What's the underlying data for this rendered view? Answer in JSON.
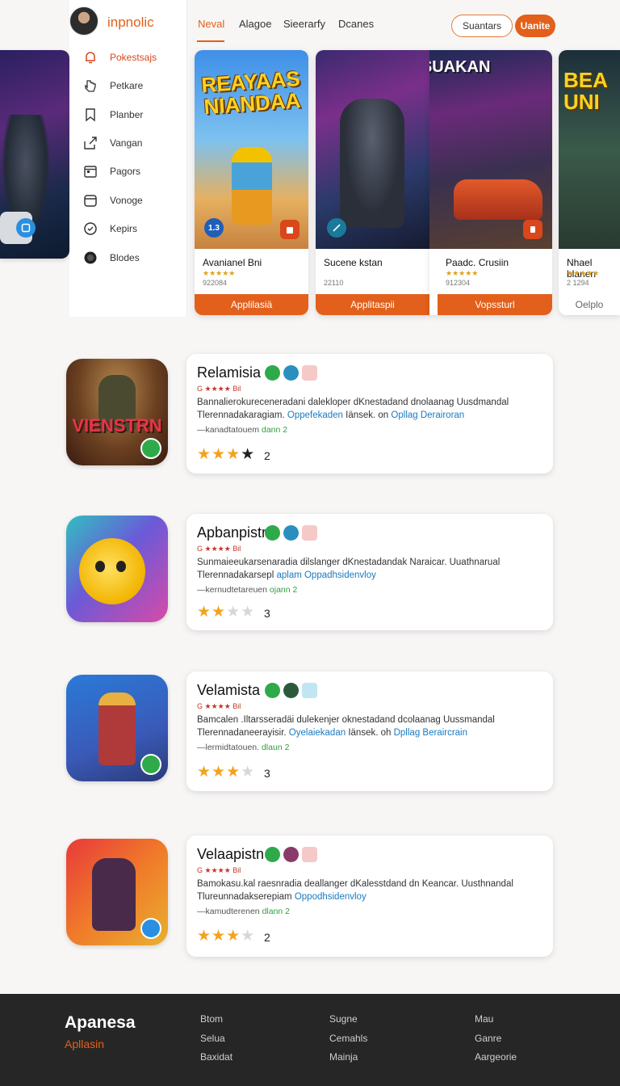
{
  "brand": {
    "name": "inpnolic"
  },
  "nav": {
    "tabs": [
      "Neval",
      "Alagoe",
      "Sieerarfy",
      "Dcanes"
    ],
    "active_tab": "Neval",
    "buttons": {
      "outline": "Suantars",
      "solid": "Uanite"
    }
  },
  "sidebar": {
    "items": [
      {
        "label": "Pokestsajs",
        "icon": "bell-icon",
        "active": true
      },
      {
        "label": "Petkare",
        "icon": "hand-pointer-icon"
      },
      {
        "label": "Planber",
        "icon": "bookmark-icon"
      },
      {
        "label": "Vangan",
        "icon": "share-icon"
      },
      {
        "label": "Pagors",
        "icon": "calendar-icon"
      },
      {
        "label": "Vonoge",
        "icon": "card-icon"
      },
      {
        "label": "Kepirs",
        "icon": "clock-icon"
      },
      {
        "label": "Blodes",
        "icon": "circle-icon"
      }
    ]
  },
  "featured": [
    {
      "art_title": "REAYAAS NIANDAA",
      "name": "Avanianel Bni",
      "stars": "★★★★★",
      "meta": "922084",
      "cta": "Applilasiä",
      "badge_left": "1.3"
    },
    {
      "art_title": "BISSUAKAN",
      "name": "Sucene kstan",
      "stars": "",
      "meta": "22110",
      "cta": "Applitaspii"
    },
    {
      "art_title": "",
      "name": "Paadc. Crusiin",
      "stars": "★★★★★",
      "meta": "912304",
      "cta": "Vopssturl"
    },
    {
      "art_title": "BEA UNI",
      "name": "Nhael blanen",
      "stars": "★★★★★",
      "meta": "2 1294",
      "cta": "Oelplo"
    }
  ],
  "apps": [
    {
      "icon_title": "VIENSTRN",
      "title": "Relamisia",
      "sub": "G ★★★★ Bil",
      "desc_a": "Bannalierokureceneradani dalekloper dKnestadand dnolaanag Uusdmandal",
      "desc_b": "Tlerennadakaragiam.",
      "link_a": "Oppefekaden",
      "desc_c": "Iänsek. on",
      "link_b": "Opllag Derairoran",
      "meta": "—kanadtatouem",
      "meta_green": "dann 2",
      "rating": 3,
      "star_style": "dark",
      "count": "2"
    },
    {
      "icon_title": "",
      "title": "Apbanpistn",
      "sub": "G ★★★★ Bil",
      "desc_a": "Sunmaieeukarsenaradia dilslanger dKnestadandak Naraicar. Uuathnarual",
      "desc_b": "Tlerennadakarsepl",
      "link_a": "aplam Oppadhsidenvloy",
      "desc_c": "",
      "link_b": "",
      "meta": "—kernudtetareuen",
      "meta_green": "ojann 2",
      "rating": 2,
      "star_style": "off",
      "count": "3"
    },
    {
      "icon_title": "",
      "title": "Velamista",
      "sub": "G ★★★★ Bil",
      "desc_a": "Bamcalen .Iltarsseradäi dulekenjer oknestadand dcolaanag Uussmandal",
      "desc_b": "Tlerennadaneerayisir.",
      "link_a": "Oyelaiekadan",
      "desc_c": "Iänsek. oh",
      "link_b": "Dpllag Beraircrain",
      "meta": "—lermidtatouen.",
      "meta_green": "dlaun 2",
      "rating": 3,
      "star_style": "off",
      "count": "3"
    },
    {
      "icon_title": "",
      "title": "Velaapistn",
      "sub": "G ★★★★ Bil",
      "desc_a": "Bamokasu.kal raesnradia deallanger dKalesstdand dn Keancar. Uusthnandal",
      "desc_b": "Tlureunnadakserepiam",
      "link_a": "Oppodhsidenvloy",
      "desc_c": "",
      "link_b": "",
      "meta": "—kamudterenen",
      "meta_green": "dlann 2",
      "rating": 3,
      "star_style": "off",
      "count": "2"
    }
  ],
  "footer": {
    "brand": "Apanesa",
    "brand_sub": "Apllasin",
    "columns": [
      [
        "Btom",
        "Selua",
        "Baxidat"
      ],
      [
        "Sugne",
        "Cemahls",
        "Mainja"
      ],
      [
        "Mau",
        "Ganre",
        "Aargeorie"
      ]
    ]
  },
  "colors": {
    "accent": "#e2601b",
    "link": "#1a7ac0",
    "star": "#f4a21d",
    "footer_bg": "#262626"
  }
}
